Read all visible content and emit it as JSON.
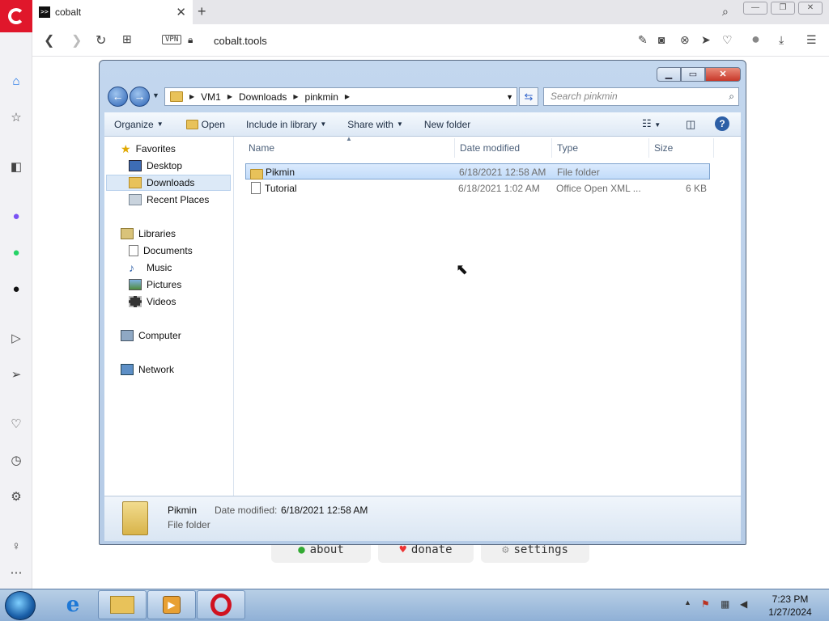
{
  "browser": {
    "tab_title": "cobalt",
    "favicon_text": ">>",
    "url": "cobalt.tools",
    "vpn_label": "VPN"
  },
  "page": {
    "buttons": [
      {
        "label": "about",
        "icon": "emoji-icon"
      },
      {
        "label": "donate",
        "icon": "heart-icon"
      },
      {
        "label": "settings",
        "icon": "gear-icon"
      }
    ]
  },
  "explorer": {
    "breadcrumb": [
      "VM1",
      "Downloads",
      "pinkmin"
    ],
    "search_placeholder": "Search pinkmin",
    "commands": {
      "organize": "Organize",
      "open": "Open",
      "include": "Include in library",
      "share": "Share with",
      "new_folder": "New folder"
    },
    "nav": {
      "favorites": "Favorites",
      "desktop": "Desktop",
      "downloads": "Downloads",
      "recent": "Recent Places",
      "libraries": "Libraries",
      "documents": "Documents",
      "music": "Music",
      "pictures": "Pictures",
      "videos": "Videos",
      "computer": "Computer",
      "network": "Network"
    },
    "columns": {
      "name": "Name",
      "date": "Date modified",
      "type": "Type",
      "size": "Size"
    },
    "files": [
      {
        "name": "Pikmin",
        "date": "6/18/2021 12:58 AM",
        "type": "File folder",
        "size": ""
      },
      {
        "name": "Tutorial",
        "date": "6/18/2021 1:02 AM",
        "type": "Office Open XML ...",
        "size": "6 KB"
      }
    ],
    "details": {
      "name": "Pikmin",
      "date_label": "Date modified:",
      "date_value": "6/18/2021 12:58 AM",
      "type": "File folder"
    }
  },
  "taskbar": {
    "time": "7:23 PM",
    "date": "1/27/2024"
  }
}
